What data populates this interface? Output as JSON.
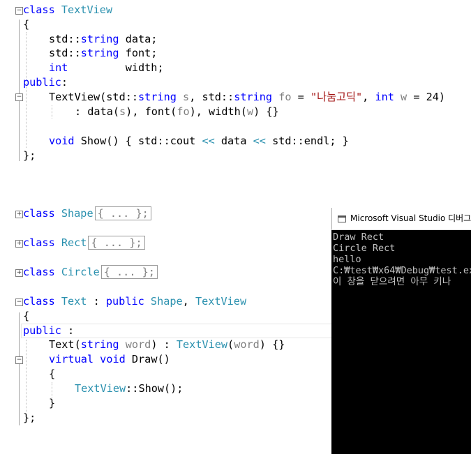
{
  "code": {
    "l1_kw": "class",
    "l1_name": "TextView",
    "brace_open": "{",
    "l3_ns": "std::",
    "l3_type": "string",
    "l3_rest": " data;",
    "l4_ns": "std::",
    "l4_type": "string",
    "l4_rest": " font;",
    "l5_type": "int",
    "l5_rest": "         width;",
    "l6_kw": "public",
    "l6_colon": ":",
    "l7_a": "TextView(std::",
    "l7_t1": "string",
    "l7_p1": " s",
    "l7_b": ", std::",
    "l7_t2": "string",
    "l7_p2": " fo",
    "l7_c": " = ",
    "l7_str": "\"나눔고딕\"",
    "l7_d": ", ",
    "l7_int": "int",
    "l7_p3": " w",
    "l7_e": " = 24)",
    "l8_a": ": data(",
    "l8_s": "s",
    "l8_b": "), font(",
    "l8_fo": "fo",
    "l8_c": "), width(",
    "l8_w": "w",
    "l8_d": ") {}",
    "l10_kw": "void",
    "l10_a": " Show() { std::cout ",
    "l10_op1": "<<",
    "l10_b": " data ",
    "l10_op2": "<<",
    "l10_c": " std::endl; }",
    "brace_close": "};",
    "shape_kw": "class",
    "shape_name": "Shape",
    "shape_box": "{ ... };",
    "rect_kw": "class",
    "rect_name": "Rect",
    "rect_box": "{ ... };",
    "circle_kw": "class",
    "circle_name": "Circle",
    "circle_box": "{ ... };",
    "text_kw": "class",
    "text_name": "Text",
    "text_colon": " : ",
    "text_pub": "public",
    "text_base1": "Shape",
    "text_comma": ", ",
    "text_base2": "TextView",
    "text_public": "public",
    "text_public_colon": " :",
    "ctor_a": "Text(",
    "ctor_t": "string",
    "ctor_p": " word",
    "ctor_b": ") : ",
    "ctor_base": "TextView",
    "ctor_c": "(",
    "ctor_p2": "word",
    "ctor_d": ") {}",
    "draw_kw1": "virtual",
    "draw_kw2": "void",
    "draw_rest": " Draw()",
    "inner_open": "{",
    "show_ns": "TextView",
    "show_rest": "::Show();",
    "inner_close": "}"
  },
  "console": {
    "title": "Microsoft Visual Studio 디버그",
    "lines": [
      "Draw Rect",
      "Circle Rect",
      "hello",
      "",
      "C:₩test₩x64₩Debug₩test.ex",
      "이 창을 닫으려면 아무 키나"
    ]
  },
  "colors": {
    "keyword": "#0000ff",
    "type": "#2b91af",
    "string": "#a31515",
    "parameter": "#808080",
    "console_bg": "#000000",
    "console_text": "#c0c0c0"
  },
  "icons": {
    "fold_collapse": "minus-box-icon",
    "fold_expand": "plus-box-icon",
    "console_window": "console-window-icon"
  },
  "fold_symbols": {
    "collapse": "−",
    "expand": "+"
  }
}
